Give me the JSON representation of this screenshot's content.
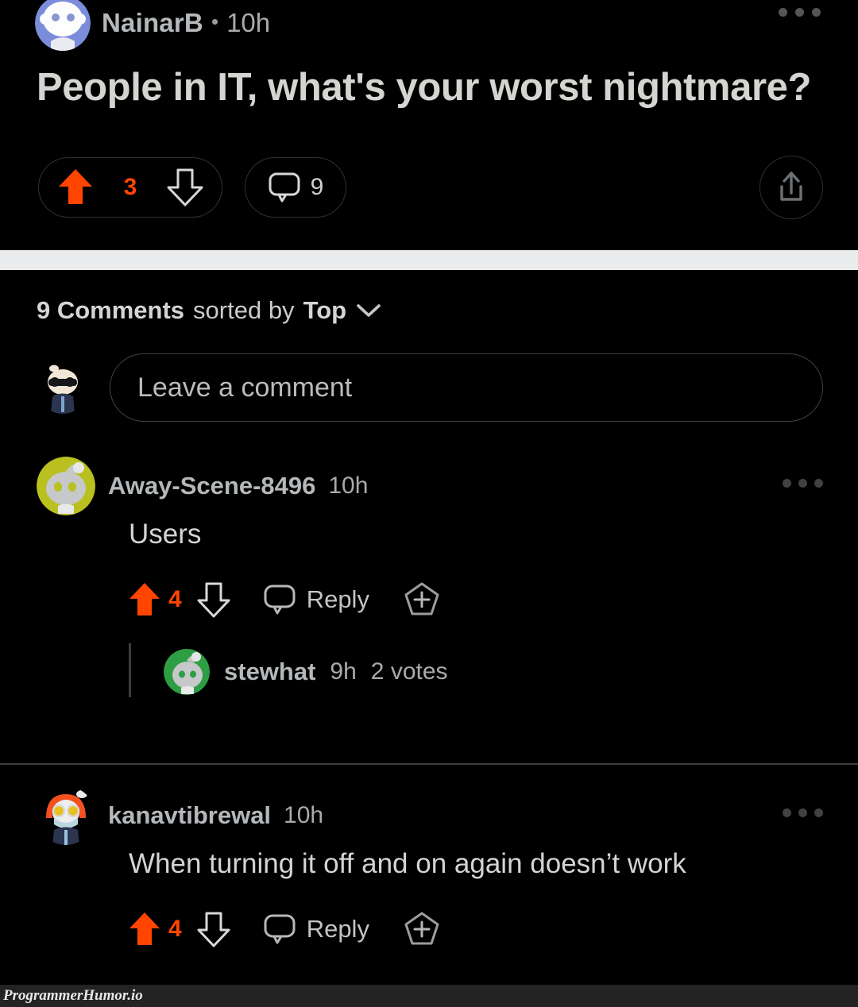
{
  "colors": {
    "background": "#000000",
    "upvote_orange": "#ff4500",
    "text_primary": "#d2d4d6",
    "text_secondary": "#a8abad",
    "divider": "#3a3c3e",
    "band": "#ebecee",
    "footer_bar": "#232323"
  },
  "post": {
    "author": "NainarB",
    "separator": "•",
    "timestamp": "10h",
    "title": "People in IT, what's your worst nightmare?",
    "overflow_icon": "kebab-menu-icon",
    "upvote_icon": "upvote-arrow-icon",
    "downvote_icon": "downvote-arrow-icon",
    "score": "3",
    "comment_icon": "comment-bubble-icon",
    "comment_count": "9",
    "share_icon": "share-icon"
  },
  "comments_section": {
    "count_label": "9 Comments",
    "sorted_by_label": "sorted by",
    "sort_value": "Top",
    "sort_chevron_icon": "chevron-down-icon",
    "composer": {
      "avatar": "user-avatar-sunglasses",
      "placeholder": "Leave a comment"
    },
    "items": [
      {
        "author": "Away-Scene-8496",
        "timestamp": "10h",
        "body": "Users",
        "avatar": "snoo-avatar-olive",
        "score": "4",
        "upvote_icon": "upvote-arrow-icon",
        "downvote_icon": "downvote-arrow-icon",
        "reply_icon": "comment-bubble-icon",
        "reply_label": "Reply",
        "award_icon": "award-plus-icon",
        "overflow_icon": "kebab-menu-icon",
        "replies": [
          {
            "author": "stewhat",
            "timestamp": "9h",
            "votes_label": "2 votes",
            "avatar": "snoo-avatar-green"
          }
        ]
      },
      {
        "author": "kanavtibrewal",
        "timestamp": "10h",
        "body": "When turning it off and on again doesn’t work",
        "avatar": "snoo-avatar-orange-hood",
        "score": "4",
        "upvote_icon": "upvote-arrow-icon",
        "downvote_icon": "downvote-arrow-icon",
        "reply_icon": "comment-bubble-icon",
        "reply_label": "Reply",
        "award_icon": "award-plus-icon",
        "overflow_icon": "kebab-menu-icon",
        "replies": []
      }
    ]
  },
  "footer": {
    "watermark": "ProgrammerHumor.io"
  }
}
